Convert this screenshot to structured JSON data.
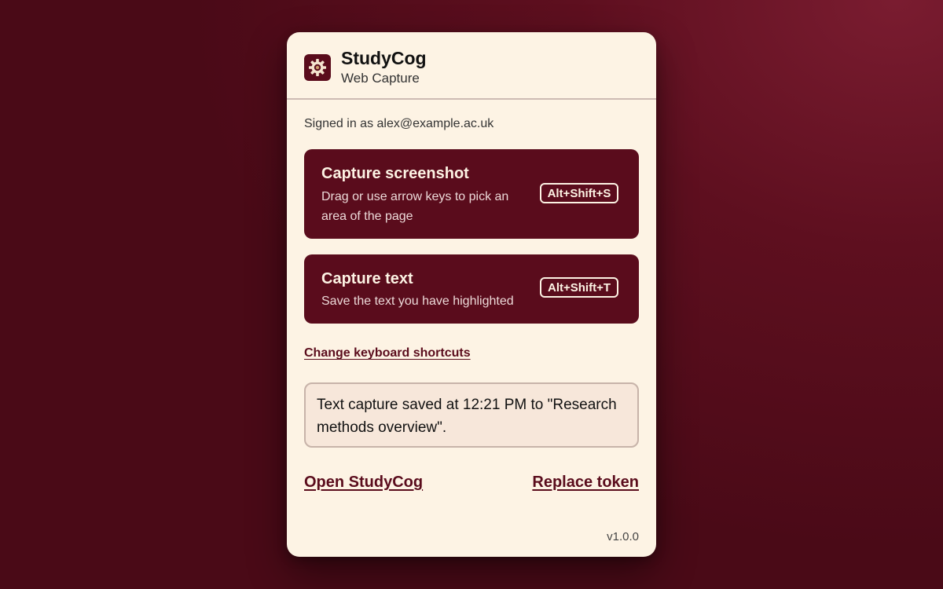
{
  "app": {
    "name": "StudyCog",
    "subtitle": "Web Capture",
    "logo_icon": "gear-cog-icon"
  },
  "account": {
    "signed_in_text": "Signed in as alex@example.ac.uk"
  },
  "actions": [
    {
      "title": "Capture screenshot",
      "description": "Drag or use arrow keys to pick an area of the page",
      "shortcut": "Alt+Shift+S"
    },
    {
      "title": "Capture text",
      "description": "Save the text you have highlighted",
      "shortcut": "Alt+Shift+T"
    }
  ],
  "links": {
    "change_shortcuts": "Change keyboard shortcuts",
    "open_app": "Open StudyCog",
    "replace_token": "Replace token"
  },
  "status": {
    "message": "Text capture saved at 12:21 PM to \"Research methods overview\"."
  },
  "version": "v1.0.0",
  "colors": {
    "accent": "#5a0c1c",
    "panel_bg": "#fdf3e4",
    "status_bg": "#f7e7da",
    "page_bg": "#5e0f1f"
  }
}
